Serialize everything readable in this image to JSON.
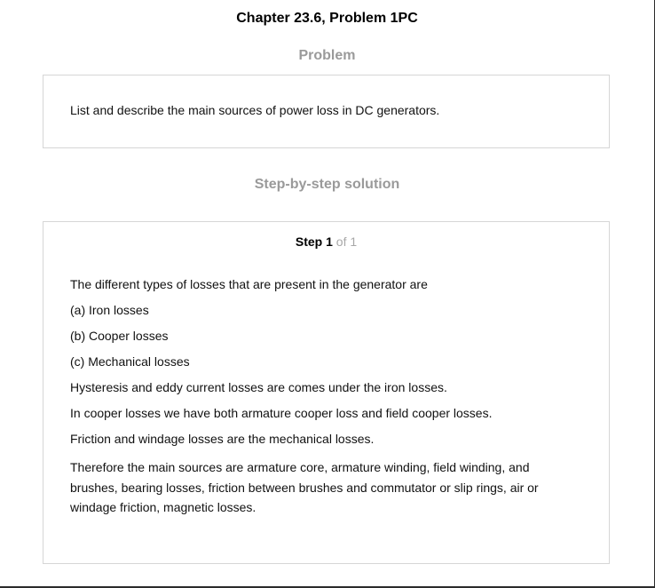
{
  "header": {
    "chapter_title": "Chapter 23.6, Problem 1PC"
  },
  "problem": {
    "heading": "Problem",
    "text": "List and describe the main sources of power loss in DC generators."
  },
  "solution": {
    "heading": "Step-by-step solution",
    "step": {
      "word": "Step",
      "number": "1",
      "of_text": "of 1"
    },
    "lines": [
      "The different types of losses that are present in the generator are",
      "(a) Iron losses",
      "(b) Cooper losses",
      "(c) Mechanical losses",
      "Hysteresis and eddy current losses are comes under the iron losses.",
      "In cooper losses we have both armature cooper loss and field cooper losses.",
      "Friction and windage losses are the mechanical losses."
    ],
    "conclusion": "Therefore the main sources are armature core, armature winding, field winding, and brushes, bearing losses, friction between brushes and commutator or slip rings, air or windage friction, magnetic losses."
  }
}
